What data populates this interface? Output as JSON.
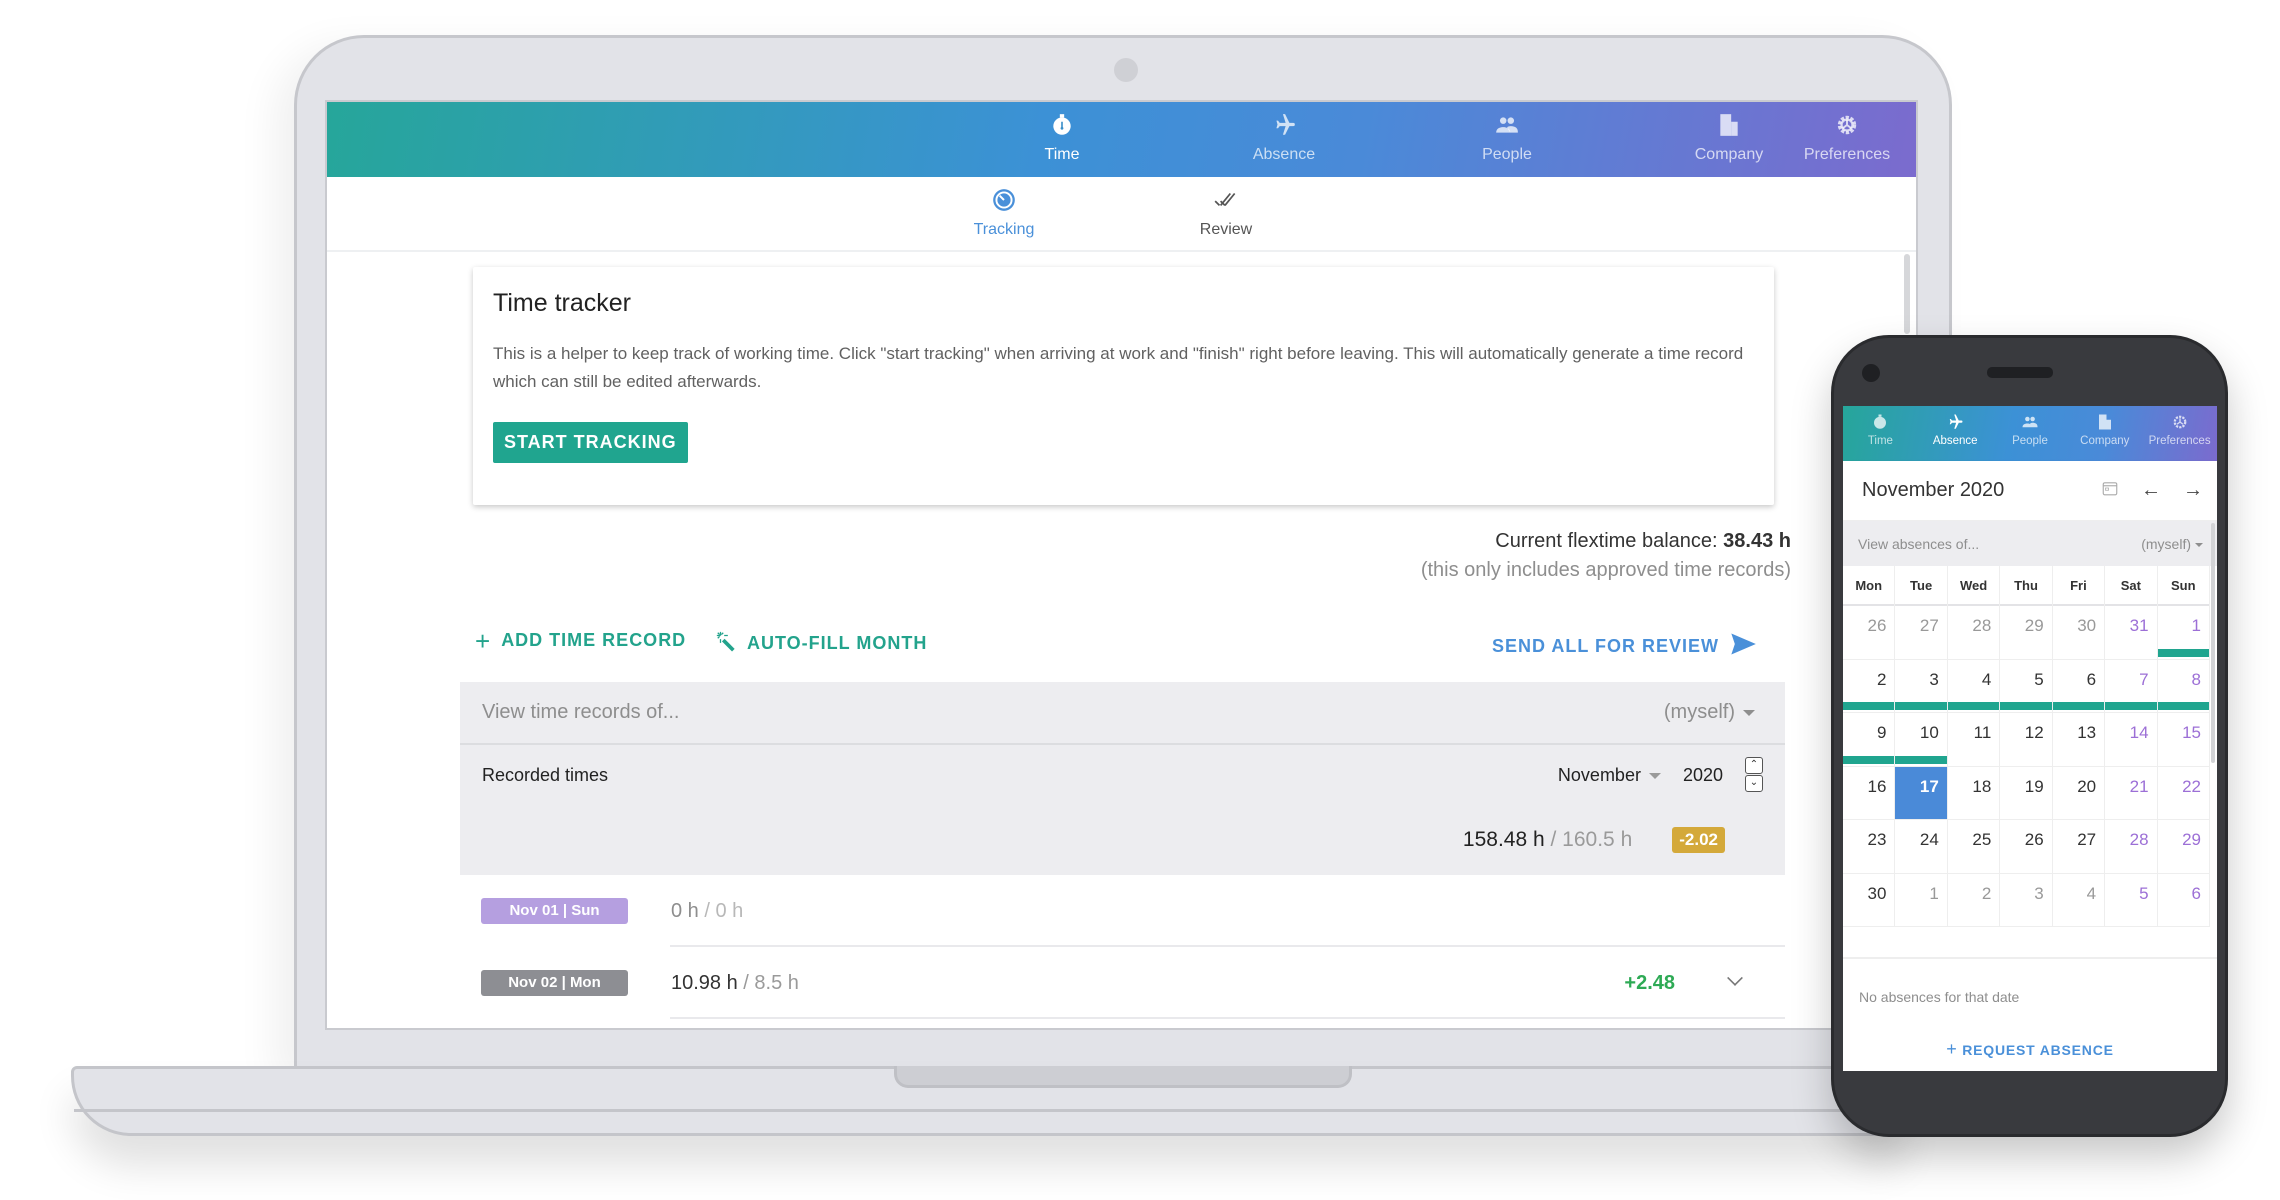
{
  "laptop": {
    "nav": [
      {
        "label": "Time",
        "icon": "stopwatch-icon",
        "active": true
      },
      {
        "label": "Absence",
        "icon": "airplane-icon",
        "active": false
      },
      {
        "label": "People",
        "icon": "people-icon",
        "active": false
      },
      {
        "label": "Company",
        "icon": "building-icon",
        "active": false
      },
      {
        "label": "Preferences",
        "icon": "gear-icon",
        "active": false
      }
    ],
    "subnav": [
      {
        "label": "Tracking",
        "icon": "timer-icon",
        "active": true
      },
      {
        "label": "Review",
        "icon": "double-check-icon",
        "active": false
      }
    ],
    "tracker": {
      "title": "Time tracker",
      "description": "This is a helper to keep track of working time. Click \"start tracking\" when arriving at work and \"finish\" right before leaving. This will automatically generate a time record which can still be edited afterwards.",
      "start_label": "START TRACKING"
    },
    "balance": {
      "label": "Current flextime balance:",
      "value": "38.43 h",
      "note": "(this only includes approved time records)"
    },
    "actions": {
      "add_label": "ADD TIME RECORD",
      "autofill_label": "AUTO-FILL MONTH",
      "send_label": "SEND ALL FOR REVIEW"
    },
    "records": {
      "filter_placeholder": "View time records of...",
      "filter_value": "(myself)",
      "recorded_label": "Recorded times",
      "month": "November",
      "year": "2020",
      "total_actual": "158.48 h",
      "total_target": "/ 160.5 h",
      "total_diff": "-2.02",
      "days": [
        {
          "chip": "Nov 01 | Sun",
          "chip_color": "#b59fe0",
          "actual": "0 h",
          "target": "/ 0 h",
          "diff": ""
        },
        {
          "chip": "Nov 02 | Mon",
          "chip_color": "#8d8e93",
          "actual": "10.98 h",
          "target": "/ 8.5 h",
          "diff": "+2.48"
        }
      ]
    }
  },
  "phone": {
    "nav": [
      {
        "label": "Time",
        "active": false
      },
      {
        "label": "Absence",
        "active": true
      },
      {
        "label": "People",
        "active": false
      },
      {
        "label": "Company",
        "active": false
      },
      {
        "label": "Preferences",
        "active": false
      }
    ],
    "calendar_title": "November 2020",
    "filter_placeholder": "View absences of...",
    "filter_value": "(myself)",
    "weekdays": [
      "Mon",
      "Tue",
      "Wed",
      "Thu",
      "Fri",
      "Sat",
      "Sun"
    ],
    "days": [
      {
        "d": "26",
        "t": "other"
      },
      {
        "d": "27",
        "t": "other"
      },
      {
        "d": "28",
        "t": "other"
      },
      {
        "d": "29",
        "t": "other"
      },
      {
        "d": "30",
        "t": "other"
      },
      {
        "d": "31",
        "t": "weekend"
      },
      {
        "d": "1",
        "t": "weekend",
        "absence": true
      },
      {
        "d": "2",
        "t": "",
        "absence": true
      },
      {
        "d": "3",
        "t": "",
        "absence": true
      },
      {
        "d": "4",
        "t": "",
        "absence": true
      },
      {
        "d": "5",
        "t": "",
        "absence": true
      },
      {
        "d": "6",
        "t": "",
        "absence": true
      },
      {
        "d": "7",
        "t": "weekend",
        "absence": true
      },
      {
        "d": "8",
        "t": "weekend",
        "absence": true
      },
      {
        "d": "9",
        "t": "",
        "absence": true
      },
      {
        "d": "10",
        "t": "",
        "absence": true
      },
      {
        "d": "11",
        "t": ""
      },
      {
        "d": "12",
        "t": ""
      },
      {
        "d": "13",
        "t": ""
      },
      {
        "d": "14",
        "t": "weekend"
      },
      {
        "d": "15",
        "t": "weekend"
      },
      {
        "d": "16",
        "t": ""
      },
      {
        "d": "17",
        "t": "today"
      },
      {
        "d": "18",
        "t": ""
      },
      {
        "d": "19",
        "t": ""
      },
      {
        "d": "20",
        "t": ""
      },
      {
        "d": "21",
        "t": "weekend"
      },
      {
        "d": "22",
        "t": "weekend"
      },
      {
        "d": "23",
        "t": ""
      },
      {
        "d": "24",
        "t": ""
      },
      {
        "d": "25",
        "t": ""
      },
      {
        "d": "26",
        "t": ""
      },
      {
        "d": "27",
        "t": ""
      },
      {
        "d": "28",
        "t": "weekend"
      },
      {
        "d": "29",
        "t": "weekend"
      },
      {
        "d": "30",
        "t": ""
      },
      {
        "d": "1",
        "t": "other"
      },
      {
        "d": "2",
        "t": "other"
      },
      {
        "d": "3",
        "t": "other"
      },
      {
        "d": "4",
        "t": "other"
      },
      {
        "d": "5",
        "t": "weekend"
      },
      {
        "d": "6",
        "t": "weekend"
      }
    ],
    "empty_text": "No absences for that date",
    "request_label": "REQUEST ABSENCE"
  },
  "colors": {
    "accent_teal": "#20a58f",
    "accent_blue": "#4a90d9",
    "weekend_purple": "#9c6fd6",
    "negative_badge": "#d4a93a",
    "positive_green": "#2eaa55"
  }
}
